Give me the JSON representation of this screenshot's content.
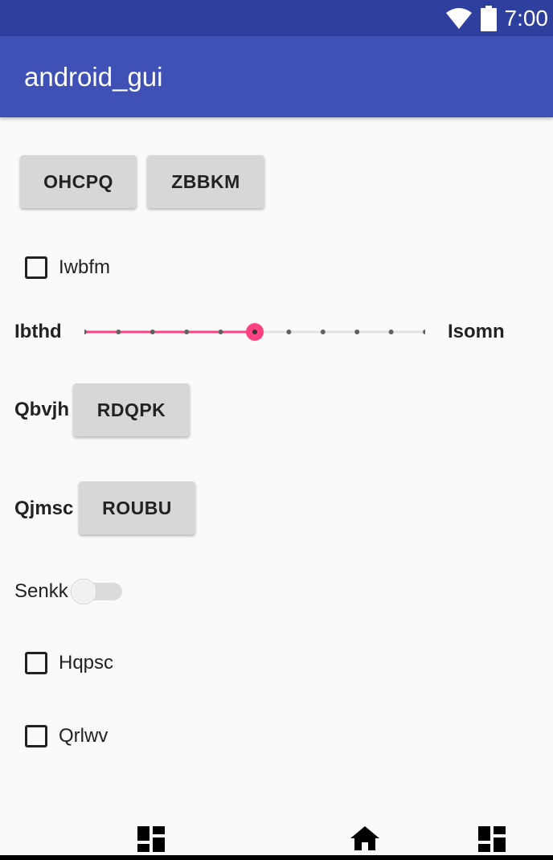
{
  "status_bar": {
    "time": "7:00",
    "icons": [
      "wifi-icon",
      "battery-icon"
    ]
  },
  "app_bar": {
    "title": "android_gui"
  },
  "buttons_row": {
    "button1": "OHCPQ",
    "button2": "ZBBKM"
  },
  "checkbox1": {
    "label": "Iwbfm",
    "checked": false
  },
  "slider": {
    "left_label": "Ibthd",
    "right_label": "Isomn",
    "value": 5,
    "max": 10
  },
  "row_qbvjh": {
    "label": "Qbvjh",
    "button": "RDQPK"
  },
  "row_qjmsc": {
    "label": "Qjmsc",
    "button": "ROUBU"
  },
  "switch": {
    "label": "Senkk",
    "on": false
  },
  "checkbox2": {
    "label": "Hqpsc",
    "checked": false
  },
  "checkbox3": {
    "label": "Qrlwv",
    "checked": false
  },
  "nav_bar": {
    "icons": [
      "dashboard-icon",
      "home-icon",
      "dashboard-icon"
    ]
  },
  "colors": {
    "accent": "#ff4081",
    "primary": "#3f51b5",
    "primary_dark": "#303f9f"
  }
}
